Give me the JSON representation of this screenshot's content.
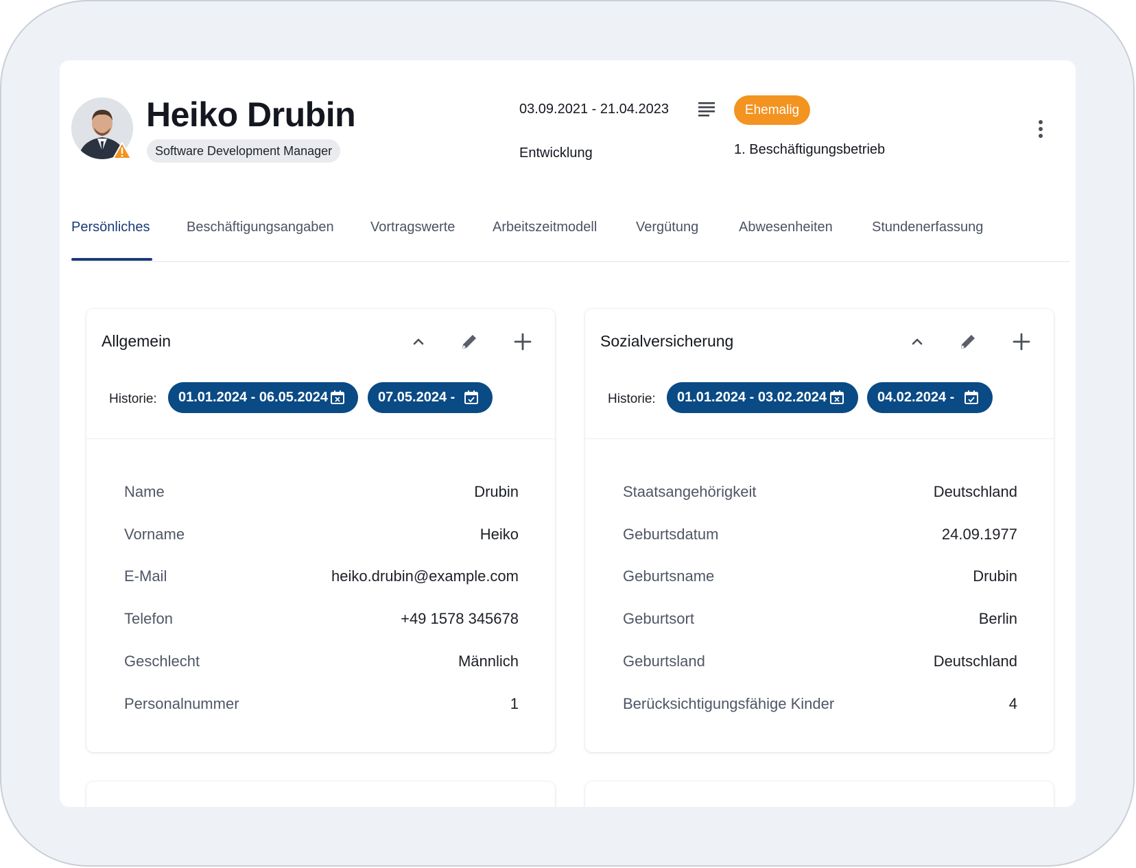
{
  "employee": {
    "name": "Heiko Drubin",
    "role": "Software Development Manager",
    "period": "03.09.2021 - 21.04.2023",
    "status": "Ehemalig",
    "department": "Entwicklung",
    "employment": "1. Beschäftigungsbetrieb"
  },
  "tabs": [
    {
      "label": "Persönliches",
      "active": true
    },
    {
      "label": "Beschäftigungsangaben",
      "active": false
    },
    {
      "label": "Vortragswerte",
      "active": false
    },
    {
      "label": "Arbeitszeitmodell",
      "active": false
    },
    {
      "label": "Vergütung",
      "active": false
    },
    {
      "label": "Abwesenheiten",
      "active": false
    },
    {
      "label": "Stundenerfassung",
      "active": false
    }
  ],
  "cards": {
    "allgemein": {
      "title": "Allgemein",
      "historie_label": "Historie:",
      "history": [
        "01.01.2024 - 06.05.2024",
        "07.05.2024 -"
      ],
      "rows": [
        {
          "label": "Name",
          "value": "Drubin"
        },
        {
          "label": "Vorname",
          "value": "Heiko"
        },
        {
          "label": "E-Mail",
          "value": "heiko.drubin@example.com"
        },
        {
          "label": "Telefon",
          "value": "+49 1578 345678"
        },
        {
          "label": "Geschlecht",
          "value": "Männlich"
        },
        {
          "label": "Personalnummer",
          "value": "1"
        }
      ]
    },
    "sozialversicherung": {
      "title": "Sozialversicherung",
      "historie_label": "Historie:",
      "history": [
        "01.01.2024 - 03.02.2024",
        "04.02.2024 -"
      ],
      "rows": [
        {
          "label": "Staatsangehörigkeit",
          "value": "Deutschland"
        },
        {
          "label": "Geburtsdatum",
          "value": "24.09.1977"
        },
        {
          "label": "Geburtsname",
          "value": "Drubin"
        },
        {
          "label": "Geburtsort",
          "value": "Berlin"
        },
        {
          "label": "Geburtsland",
          "value": "Deutschland"
        },
        {
          "label": "Berücksichtigungsfähige Kinder",
          "value": "4"
        }
      ]
    }
  },
  "icons": {
    "avatar_warning": "warning-icon",
    "notes": "notes-lines-icon",
    "more": "more-vertical-icon",
    "collapse": "chevron-up-icon",
    "edit": "pencil-icon",
    "add": "plus-icon",
    "history_closed": "calendar-x-icon",
    "history_open": "calendar-check-icon"
  },
  "colors": {
    "accent": "#1a3a78",
    "history_chip": "#0a4a85",
    "status": "#f39320",
    "warning": "#f39320"
  }
}
